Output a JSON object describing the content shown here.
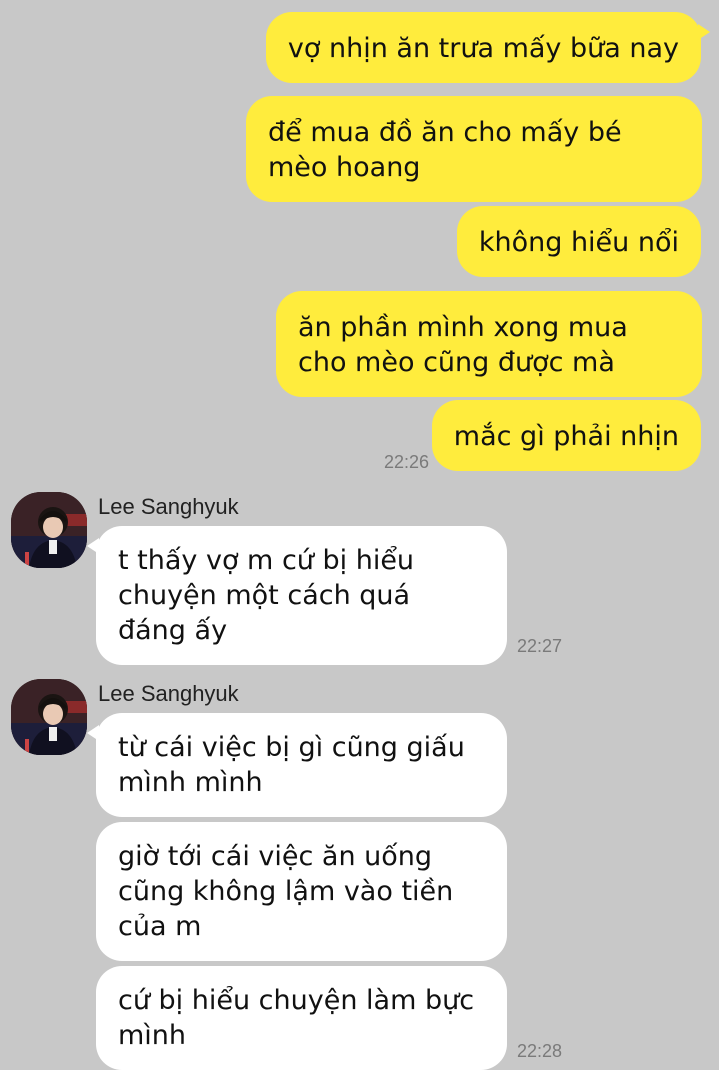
{
  "outgoing": [
    {
      "text": "vợ nhịn ăn trưa mấy bữa nay"
    },
    {
      "text": "để mua đồ ăn cho mấy bé mèo hoang"
    },
    {
      "text": "không hiểu nổi"
    },
    {
      "text": "ăn phần mình xong mua cho mèo cũng được mà"
    },
    {
      "text": "mắc gì phải nhịn"
    }
  ],
  "outgoing_time": "22:26",
  "groups": [
    {
      "sender": "Lee Sanghyuk",
      "avatar_icon": "profile-photo",
      "messages": [
        {
          "text": "t thấy vợ m cứ bị hiểu chuyện một cách quá đáng ấy"
        }
      ],
      "time": "22:27"
    },
    {
      "sender": "Lee Sanghyuk",
      "avatar_icon": "profile-photo",
      "messages": [
        {
          "text": "từ cái việc bị gì cũng giấu mình mình"
        },
        {
          "text": "giờ tới cái việc ăn uống cũng không lậm vào tiền của m"
        },
        {
          "text": "cứ bị hiểu chuyện làm bực mình"
        }
      ],
      "time": "22:28"
    }
  ],
  "colors": {
    "background": "#c8c8c8",
    "outgoing_bubble": "#ffec3d",
    "incoming_bubble": "#ffffff",
    "timestamp": "#7a7a7a"
  }
}
